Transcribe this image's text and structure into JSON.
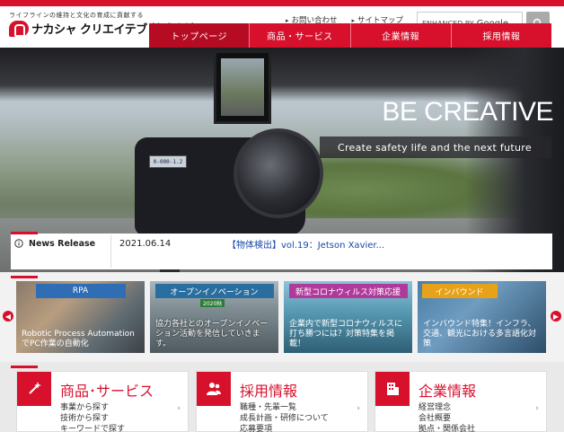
{
  "header": {
    "tagline": "ライフラインの維持と文化の育成に貢献する",
    "logo_text": "ナカシャ クリエイテブ 株式会社",
    "util_links": [
      "お問い合わせ",
      "サイトマップ"
    ],
    "search_placeholder": "ENHANCED BY",
    "search_brand": "Google"
  },
  "nav": {
    "items": [
      "トップページ",
      "商品・サービス",
      "企業情報",
      "採用情報"
    ],
    "active_index": 0
  },
  "hero": {
    "title": "BE CREATIVE",
    "subtitle": "Create safety life and the next future",
    "camera_display": "0-000-1.2"
  },
  "news": {
    "label": "News Release",
    "date": "2021.06.14",
    "link_text": "【物体検出】vol.19：Jetson Xavier..."
  },
  "banners": [
    {
      "tag": "RPA",
      "tag_color": "#2f6db4",
      "caption": "Robotic Process Automation でPC作業の自動化"
    },
    {
      "tag": "オープンイノベーション",
      "tag_color": "#2a6ea0",
      "badge": "2020秋",
      "caption": "協力各社とのオープンイノベーション活動を発信していきます。"
    },
    {
      "tag": "新型コロナウィルス対策応援",
      "tag_color": "#b03a9a",
      "caption": "企業内で新型コロナウィルスに打ち勝つには？対策特集を掲載！"
    },
    {
      "tag": "インバウンド",
      "tag_color": "#e8a21a",
      "caption": "インバウンド特集！インフラ、交通、観光における多言語化対策"
    }
  ],
  "cards": [
    {
      "title": "商品･サービス",
      "icon": "magic-wand-icon",
      "items": [
        "事業から探す",
        "技術から探す",
        "キーワードで探す"
      ]
    },
    {
      "title": "採用情報",
      "icon": "people-icon",
      "items": [
        "職種・先輩一覧",
        "成長計画・研修について",
        "応募要項"
      ]
    },
    {
      "title": "企業情報",
      "icon": "building-icon",
      "items": [
        "経営理念",
        "会社概要",
        "拠点・関係会社"
      ]
    }
  ],
  "colors": {
    "brand": "#d7102c",
    "link": "#1a48a8"
  }
}
